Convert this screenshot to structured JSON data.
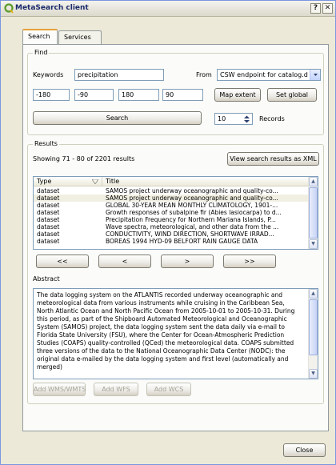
{
  "window": {
    "title": "MetaSearch client",
    "help_btn": "?",
    "close_btn": "✕"
  },
  "tabs": [
    {
      "label": "Search",
      "active": true
    },
    {
      "label": "Services",
      "active": false
    }
  ],
  "find": {
    "group_title": "Find",
    "keywords_label": "Keywords",
    "keywords_value": "precipitation",
    "from_label": "From",
    "from_value": "CSW endpoint for catalog.d",
    "bbox": [
      "-180",
      "-90",
      "180",
      "90"
    ],
    "map_extent_label": "Map extent",
    "set_global_label": "Set global",
    "search_label": "Search",
    "records_value": "10",
    "records_label": "Records"
  },
  "results": {
    "group_title": "Results",
    "status": "Showing 71 - 80 of 2201 results",
    "view_xml_label": "View search results as XML",
    "columns": [
      "Type",
      "Title"
    ],
    "rows": [
      {
        "type": "dataset",
        "title": "SAMOS project underway oceanographic and quality-co..."
      },
      {
        "type": "dataset",
        "title": "SAMOS project underway oceanographic and quality-co..."
      },
      {
        "type": "dataset",
        "title": "GLOBAL 30-YEAR MEAN MONTHLY CLIMATOLOGY, 1901-..."
      },
      {
        "type": "dataset",
        "title": "Growth responses of subalpine fir (Abies lasiocarpa) to d..."
      },
      {
        "type": "dataset",
        "title": "Precipitation Frequency for Northern Mariana Islands, P..."
      },
      {
        "type": "dataset",
        "title": "Wave spectra, meteorological, and other data from the ..."
      },
      {
        "type": "dataset",
        "title": "CONDUCTIVITY, WIND DIRECTION, SHORTWAVE IRRAD..."
      },
      {
        "type": "dataset",
        "title": "BOREAS 1994 HYD-09 BELFORT RAIN GAUGE DATA"
      }
    ],
    "nav": [
      "<<",
      "<",
      ">",
      ">>"
    ],
    "abstract_label": "Abstract",
    "abstract_text": "The data logging system on the ATLANTIS recorded underway oceanographic and meteorological data from various instruments while cruising in the Caribbean Sea, North Atlantic Ocean and North Pacific Ocean from 2005-10-01 to 2005-10-31. During this period, as part of the Shipboard Automated Meteorological and Oceanographic System (SAMOS) project, the data logging system sent the data daily via e-mail to Florida State University (FSU), where the Center for Ocean-Atmospheric Prediction Studies (COAPS) quality-controlled (QCed) the meteorological data. COAPS submitted three versions of the data to the National Oceanographic Data Center (NODC): the original data e-mailed by the data logging system and first level (automatically and merged)",
    "add_wms_label": "Add WMS/WMTS",
    "add_wfs_label": "Add WFS",
    "add_wcs_label": "Add WCS"
  },
  "footer": {
    "close_label": "Close"
  },
  "colors": {
    "title_text": "#1a2a6c",
    "active_tab_accent": "#e6a23a",
    "field_border": "#7f9db9",
    "dialog_bg": "#ece9d8"
  },
  "icons": {
    "app": "qgis-logo-icon",
    "spin": "spin-arrows-icon",
    "combo": "chevron-down-icon"
  }
}
